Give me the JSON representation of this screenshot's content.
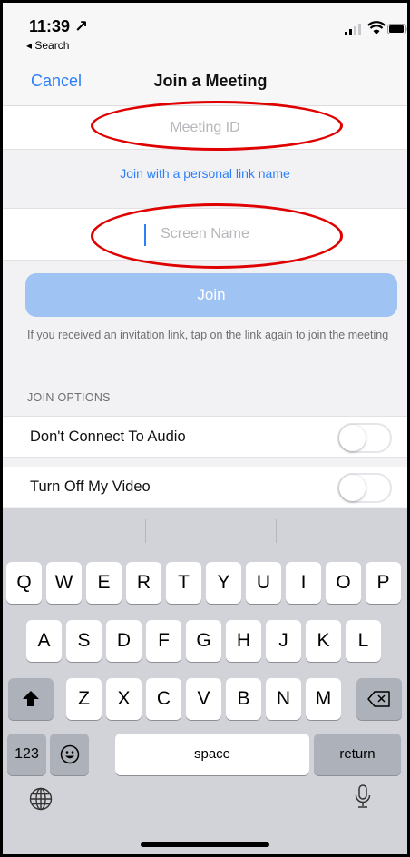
{
  "status_bar": {
    "time": "11:39 ↗",
    "back_app": "◂ Search"
  },
  "nav": {
    "cancel_label": "Cancel",
    "title": "Join a Meeting"
  },
  "meeting_id": {
    "placeholder": "Meeting ID",
    "value": ""
  },
  "personal_link_label": "Join with a personal link name",
  "screen_name": {
    "placeholder": "Screen Name",
    "value": ""
  },
  "join_label": "Join",
  "hint_text": "If you received an invitation link, tap on the link again to join the meeting",
  "options": {
    "header": "JOIN OPTIONS",
    "items": [
      {
        "label": "Don't Connect To Audio",
        "on": false
      },
      {
        "label": "Turn Off My Video",
        "on": false
      }
    ]
  },
  "keyboard": {
    "row1": [
      "Q",
      "W",
      "E",
      "R",
      "T",
      "Y",
      "U",
      "I",
      "O",
      "P"
    ],
    "row2": [
      "A",
      "S",
      "D",
      "F",
      "G",
      "H",
      "J",
      "K",
      "L"
    ],
    "row3": [
      "Z",
      "X",
      "C",
      "V",
      "B",
      "N",
      "M"
    ],
    "num_label": "123",
    "space_label": "space",
    "return_label": "return"
  },
  "colors": {
    "accent": "#2d7ff9",
    "annotation": "#e00000",
    "join_disabled": "#9fc3f3"
  }
}
